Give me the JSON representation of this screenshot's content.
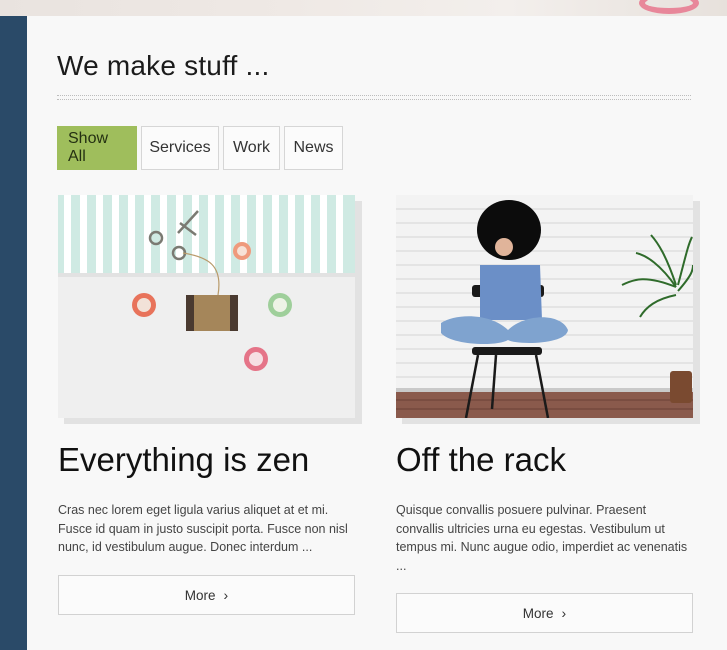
{
  "section": {
    "title": "We make stuff ..."
  },
  "filters": [
    {
      "label": "Show All",
      "active": true
    },
    {
      "label": "Services",
      "active": false
    },
    {
      "label": "Work",
      "active": false
    },
    {
      "label": "News",
      "active": false
    }
  ],
  "cards": [
    {
      "title": "Everything is zen",
      "text": "Cras nec lorem eget ligula varius aliquet at et mi. Fusce id quam in justo suscipit porta. Fusce non nisl nunc, id vestibulum augue. Donec interdum ...",
      "more_label": "More",
      "image": "craft-supplies-photo"
    },
    {
      "title": "Off the rack",
      "text": "Quisque convallis posuere pulvinar. Praesent convallis ultricies urna eu egestas. Vestibulum ut tempus mi. Nunc augue odio, imperdiet ac venenatis ...",
      "more_label": "More",
      "image": "woman-with-hat-photo"
    }
  ],
  "colors": {
    "sidebar": "#2a4a68",
    "active_filter": "#9fbe5c"
  },
  "icons": {
    "more": "chevron-right-icon"
  }
}
